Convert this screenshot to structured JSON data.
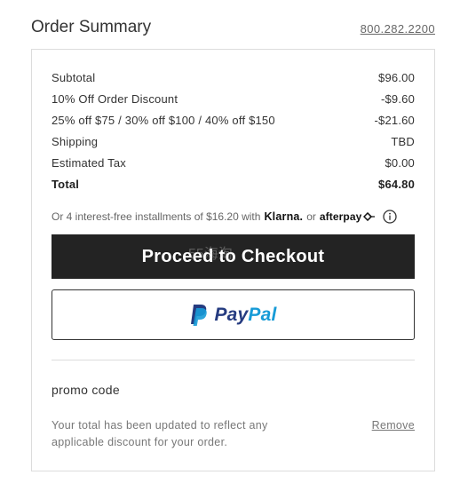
{
  "header": {
    "title": "Order Summary",
    "phone": "800.282.2200"
  },
  "summary": {
    "rows": [
      {
        "label": "Subtotal",
        "value": "$96.00"
      },
      {
        "label": "10% Off Order Discount",
        "value": "-$9.60"
      },
      {
        "label": "25% off $75 / 30% off $100 / 40% off $150",
        "value": "-$21.60"
      },
      {
        "label": "Shipping",
        "value": "TBD"
      },
      {
        "label": "Estimated Tax",
        "value": "$0.00"
      },
      {
        "label": "Total",
        "value": "$64.80"
      }
    ]
  },
  "installments": {
    "text": "Or 4 interest-free installments of $16.20 with",
    "klarna": "Klarna.",
    "or": "or",
    "afterpay": "afterpay",
    "info_icon": "info-circle-icon"
  },
  "checkout": {
    "label": "Proceed to Checkout"
  },
  "paypal": {
    "pay": "Pay",
    "pal": "Pal",
    "icon": "paypal-p-icon",
    "colors": {
      "dark": "#253b80",
      "light": "#179bd7"
    }
  },
  "promo": {
    "label": "promo code",
    "message": "Your total has been updated to reflect any applicable discount for your order.",
    "remove_label": "Remove"
  },
  "watermark": "55海淘",
  "colors": {
    "checkout_bg": "#232323",
    "border": "#dcdcdc"
  }
}
